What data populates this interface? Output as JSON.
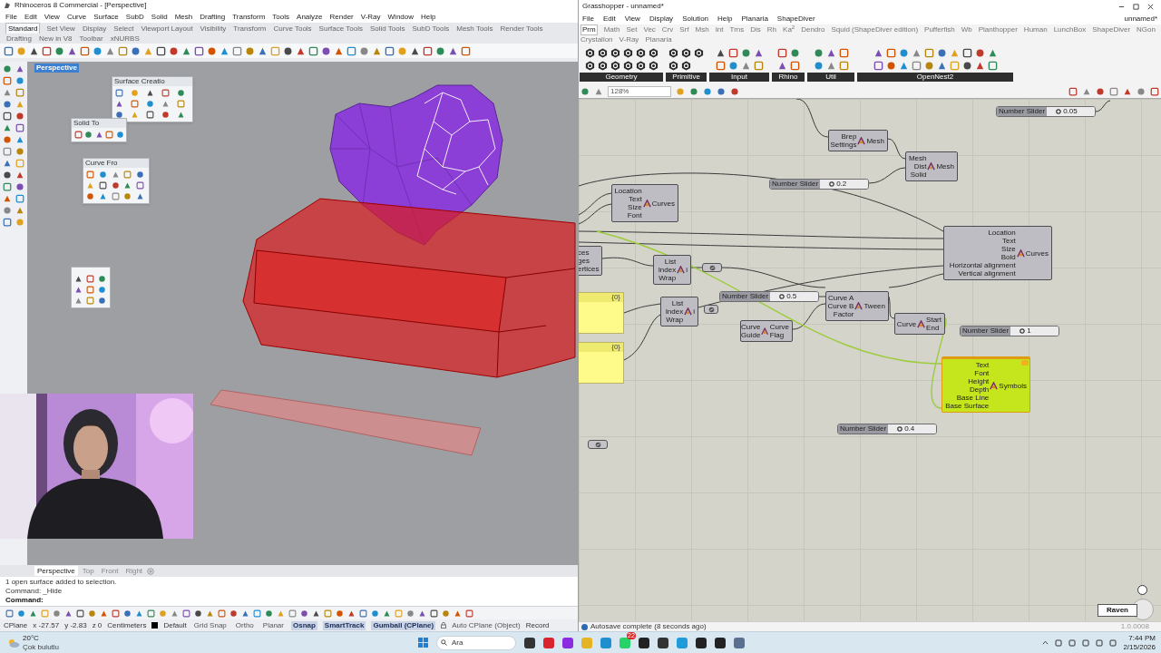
{
  "rhino": {
    "title": "Rhinoceros 8 Commercial - [Perspective]",
    "menu": [
      "File",
      "Edit",
      "View",
      "Curve",
      "Surface",
      "SubD",
      "Solid",
      "Mesh",
      "Drafting",
      "Transform",
      "Tools",
      "Analyze",
      "Render",
      "V-Ray",
      "Window",
      "Help"
    ],
    "toolbar_tabs": [
      {
        "label": "Standard",
        "selected": true
      },
      {
        "label": "Set View",
        "selected": false
      },
      {
        "label": "Display",
        "selected": false
      },
      {
        "label": "Select",
        "selected": false
      },
      {
        "label": "Viewport Layout",
        "selected": false
      },
      {
        "label": "Visibility",
        "selected": false
      },
      {
        "label": "Transform",
        "selected": false
      },
      {
        "label": "Curve Tools",
        "selected": false
      },
      {
        "label": "Surface Tools",
        "selected": false
      },
      {
        "label": "Solid Tools",
        "selected": false
      },
      {
        "label": "SubD Tools",
        "selected": false
      },
      {
        "label": "Mesh Tools",
        "selected": false
      },
      {
        "label": "Render Tools",
        "selected": false
      },
      {
        "label": "Drafting",
        "selected": false
      },
      {
        "label": "New in V8",
        "selected": false
      },
      {
        "label": "Toolbar",
        "selected": false
      },
      {
        "label": "xNURBS",
        "selected": false
      }
    ],
    "viewport_label": "Perspective",
    "floating_panels": [
      {
        "title": "Surface Creatio"
      },
      {
        "title": "Solid To"
      },
      {
        "title": "Curve Fro"
      }
    ],
    "viewport_tabs": [
      {
        "label": "Perspective",
        "selected": true
      },
      {
        "label": "Top",
        "selected": false
      },
      {
        "label": "Front",
        "selected": false
      },
      {
        "label": "Right",
        "selected": false
      }
    ],
    "command_history": [
      "1 open surface added to selection.",
      "Command: _Hide"
    ],
    "command_prompt": "Command:",
    "status_bar": [
      {
        "kind": "text",
        "label": "CPlane"
      },
      {
        "kind": "text",
        "label": "x -27.57"
      },
      {
        "kind": "text",
        "label": "y -2.83"
      },
      {
        "kind": "text",
        "label": "z 0"
      },
      {
        "kind": "text",
        "label": "Centimeters"
      },
      {
        "kind": "layer",
        "label": "Default"
      },
      {
        "kind": "toggle",
        "label": "Grid Snap",
        "on": false
      },
      {
        "kind": "toggle",
        "label": "Ortho",
        "on": false
      },
      {
        "kind": "toggle",
        "label": "Planar",
        "on": false
      },
      {
        "kind": "toggle",
        "label": "Osnap",
        "on": true
      },
      {
        "kind": "toggle",
        "label": "SmartTrack",
        "on": true
      },
      {
        "kind": "toggle",
        "label": "Gumball (CPlane)",
        "on": true
      },
      {
        "kind": "lock",
        "label": "Auto CPlane (Object)"
      },
      {
        "kind": "text",
        "label": "Record"
      }
    ]
  },
  "grasshopper": {
    "title": "Grasshopper - unnamed*",
    "menu": [
      "File",
      "Edit",
      "View",
      "Display",
      "Solution",
      "Help",
      "Planaria",
      "ShapeDiver"
    ],
    "document_name": "unnamed*",
    "tabs": [
      {
        "label": "Prm",
        "selected": true
      },
      {
        "label": "Math",
        "selected": false
      },
      {
        "label": "Set",
        "selected": false
      },
      {
        "label": "Vec",
        "selected": false
      },
      {
        "label": "Crv",
        "selected": false
      },
      {
        "label": "Srf",
        "selected": false
      },
      {
        "label": "Msh",
        "selected": false
      },
      {
        "label": "Int",
        "selected": false
      },
      {
        "label": "Trns",
        "selected": false
      },
      {
        "label": "Dis",
        "selected": false
      },
      {
        "label": "Rh",
        "selected": false
      },
      {
        "label": "Ka$^{2}$",
        "selected": false
      },
      {
        "label": "Dendro",
        "selected": false
      },
      {
        "label": "Squid (ShapeDiver edition)",
        "selected": false
      },
      {
        "label": "Pufferfish",
        "selected": false
      },
      {
        "label": "Wb",
        "selected": false
      },
      {
        "label": "Planthopper",
        "selected": false
      },
      {
        "label": "Human",
        "selected": false
      },
      {
        "label": "LunchBox",
        "selected": false
      },
      {
        "label": "ShapeDiver",
        "selected": false
      },
      {
        "label": "NGon",
        "selected": false
      },
      {
        "label": "Crystallon",
        "selected": false
      },
      {
        "label": "V-Ray",
        "selected": false
      },
      {
        "label": "Planaria",
        "selected": false
      }
    ],
    "panel_groups": [
      "Geometry",
      "Primitive",
      "Input",
      "Rhino",
      "Util",
      "OpenNest2"
    ],
    "zoom": "128%",
    "nodes": [
      {
        "kind": "slider",
        "label": "Number Slider",
        "value": "0.05",
        "selected": false
      },
      {
        "kind": "component",
        "inputs": [
          "Brep",
          "Settings"
        ],
        "outputs": [
          "Mesh"
        ],
        "selected": false,
        "warning": false
      },
      {
        "kind": "component",
        "inputs": [
          "Mesh",
          "Dist",
          "Solid"
        ],
        "outputs": [
          "Mesh"
        ],
        "selected": false,
        "warning": false
      },
      {
        "kind": "slider",
        "label": "Number Slider",
        "value": "0.2",
        "selected": false
      },
      {
        "kind": "component",
        "inputs": [
          "Location",
          "Text",
          "Size",
          "Font"
        ],
        "outputs": [
          "Curves"
        ],
        "selected": false,
        "warning": false
      },
      {
        "kind": "component",
        "outputs": [
          "ces",
          "ges",
          "ertices"
        ],
        "selected": false,
        "warning": false
      },
      {
        "kind": "component",
        "inputs": [
          "List",
          "Index",
          "Wrap"
        ],
        "outputs": [
          "i"
        ],
        "selected": false,
        "warning": false
      },
      {
        "kind": "param",
        "selected": false
      },
      {
        "kind": "component",
        "inputs": [
          "Location",
          "Text",
          "Size",
          "Bold",
          "Horizontal alignment",
          "Vertical alignment"
        ],
        "outputs": [
          "Curves"
        ],
        "selected": false,
        "warning": false
      },
      {
        "kind": "panel",
        "header": "{0}",
        "selected": false
      },
      {
        "kind": "component",
        "inputs": [
          "List",
          "Index",
          "Wrap"
        ],
        "outputs": [
          "i"
        ],
        "selected": false,
        "warning": false
      },
      {
        "kind": "slider",
        "label": "Number Slider",
        "value": "0.5",
        "selected": false
      },
      {
        "kind": "param",
        "selected": false
      },
      {
        "kind": "component",
        "inputs": [
          "Curve A",
          "Curve B",
          "Factor"
        ],
        "outputs": [
          "Tween"
        ],
        "selected": false,
        "warning": false
      },
      {
        "kind": "component",
        "inputs": [
          "Curve",
          "Guide"
        ],
        "outputs": [
          "Curve",
          "Flag"
        ],
        "selected": false,
        "warning": false
      },
      {
        "kind": "component",
        "inputs": [
          "Curve"
        ],
        "outputs": [
          "Start",
          "End"
        ],
        "selected": false,
        "warning": false
      },
      {
        "kind": "slider",
        "label": "Number Slider",
        "value": "1",
        "selected": false
      },
      {
        "kind": "panel",
        "header": "{0}",
        "selected": false
      },
      {
        "kind": "component",
        "inputs": [
          "Text",
          "Font",
          "Height",
          "Depth",
          "Base Line",
          "Base Surface"
        ],
        "outputs": [
          "Symbols"
        ],
        "selected": true,
        "warning": true
      },
      {
        "kind": "slider",
        "label": "Number Slider",
        "value": "0.4",
        "selected": false
      },
      {
        "kind": "param",
        "selected": false
      }
    ],
    "status": "Autosave complete (8 seconds ago)",
    "version": "1.0.0008",
    "widget_label": "Raven"
  },
  "taskbar": {
    "weather_temp": "20°C",
    "weather_desc": "Çok bulutlu",
    "search_placeholder": "Ara",
    "badge": "22",
    "time": "7:44 PM",
    "date": "2/15/2026"
  }
}
